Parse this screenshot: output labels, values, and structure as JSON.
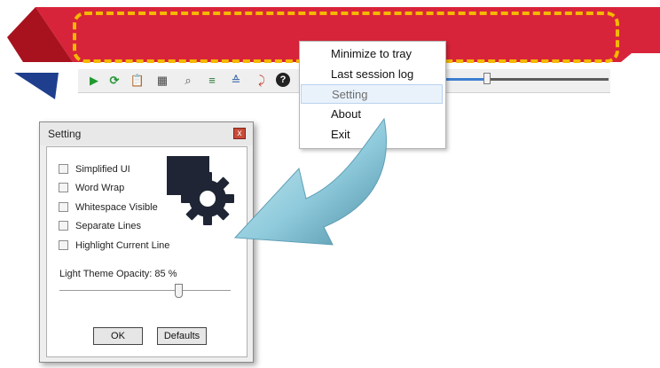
{
  "colors": {
    "banner_red": "#d8243a",
    "banner_dark_red": "#a8121e",
    "blue_accent": "#1f3f8e",
    "dashed_highlight": "#f5b800",
    "arrow_fill": "#8fcbdc"
  },
  "toolbar": {
    "icons": [
      "play-icon",
      "refresh-icon",
      "clipboard-icon",
      "table-icon",
      "find-icon",
      "list-icon",
      "list-sort-icon",
      "pin-arrow-icon",
      "help-icon"
    ],
    "slider_value_fraction": 0.25
  },
  "context_menu": {
    "items": [
      {
        "label": "Minimize to tray"
      },
      {
        "label": "Last session log"
      },
      {
        "label": "Setting",
        "highlighted": true
      },
      {
        "label": "About"
      },
      {
        "label": "Exit"
      }
    ]
  },
  "settings_dialog": {
    "title": "Setting",
    "close_glyph": "x",
    "options": [
      {
        "label": "Simplified UI",
        "checked": false
      },
      {
        "label": "Word Wrap",
        "checked": false
      },
      {
        "label": "Whitespace Visible",
        "checked": false
      },
      {
        "label": "Separate Lines",
        "checked": false
      },
      {
        "label": "Highlight Current Line",
        "checked": false
      }
    ],
    "opacity_label": "Light Theme Opacity: 85 %",
    "opacity_value_percent": 85,
    "ok_label": "OK",
    "defaults_label": "Defaults"
  }
}
